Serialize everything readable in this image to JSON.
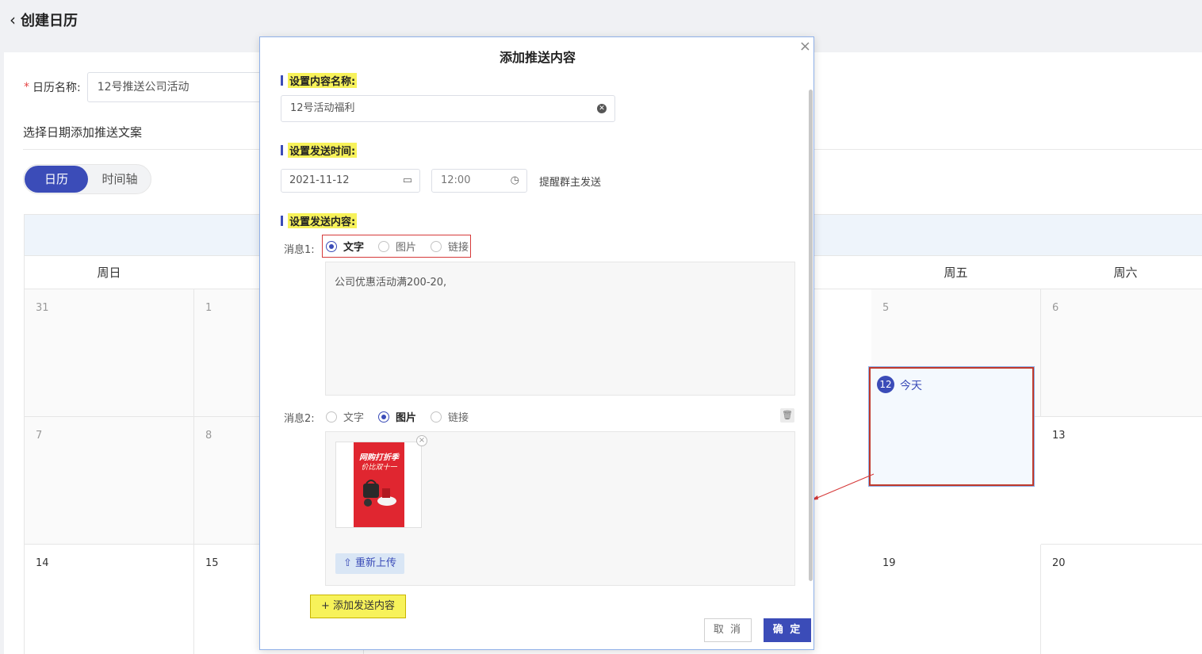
{
  "page": {
    "back_label": "创建日历"
  },
  "form": {
    "name_label": "日历名称:",
    "name_value": "12号推送公司活动",
    "section_title": "选择日期添加推送文案"
  },
  "view_toggle": {
    "calendar": "日历",
    "timeline": "时间轴"
  },
  "calendar": {
    "weekdays": [
      "周日",
      "",
      "",
      "",
      "",
      "周五",
      "周六"
    ],
    "row1": [
      "31",
      "1",
      "",
      "",
      "",
      "5",
      "6"
    ],
    "row2": [
      "7",
      "8",
      "",
      "",
      "",
      "12",
      "13"
    ],
    "row3": [
      "14",
      "15",
      "",
      "",
      "",
      "19",
      "20"
    ],
    "today_day": "12",
    "today_label": "今天"
  },
  "modal": {
    "title": "添加推送内容",
    "content_name_section": "设置内容名称:",
    "content_name_value": "12号活动福利",
    "send_time_section": "设置发送时间:",
    "date_value": "2021-11-12",
    "time_value": "12:00",
    "remind_text": "提醒群主发送",
    "send_content_section": "设置发送内容:",
    "msg1_label": "消息1:",
    "msg2_label": "消息2:",
    "opt_text": "文字",
    "opt_image": "图片",
    "opt_link": "链接",
    "msg1_text": "公司优惠活动满200-20,",
    "image_caption_1": "网购打折季",
    "image_caption_2": "价比双十一",
    "reupload_label": "重新上传",
    "add_content_label": "添加发送内容",
    "cancel_label": "取 消",
    "ok_label": "确 定"
  },
  "colors": {
    "primary": "#3b4cb8",
    "highlight": "#f7f25a",
    "annotation": "#d63a3a"
  }
}
